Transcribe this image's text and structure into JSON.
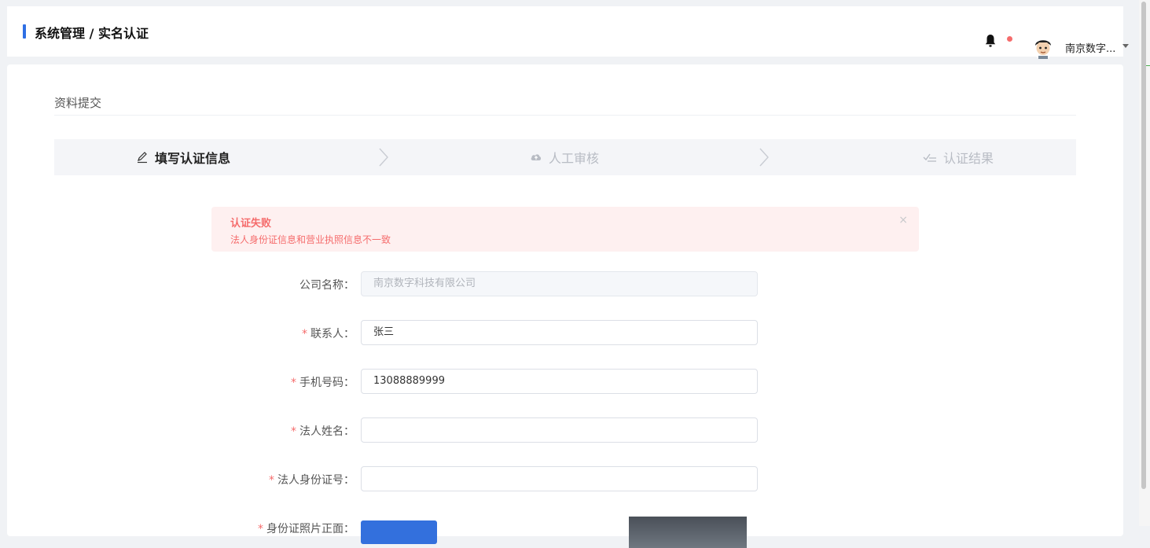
{
  "header": {
    "breadcrumb": "系统管理 / 实名认证",
    "user_name": "南京数字..."
  },
  "section": {
    "title": "资料提交"
  },
  "steps": [
    {
      "label": "填写认证信息",
      "icon": "edit-icon",
      "state": "active"
    },
    {
      "label": "人工审核",
      "icon": "cloud-upload-icon",
      "state": "inactive"
    },
    {
      "label": "认证结果",
      "icon": "check-list-icon",
      "state": "inactive"
    }
  ],
  "alert": {
    "title": "认证失败",
    "description": "法人身份证信息和营业执照信息不一致",
    "close": "×"
  },
  "form": {
    "company_name": {
      "label": "公司名称：",
      "value": "南京数字科技有限公司",
      "required": false
    },
    "contact": {
      "label": "联系人：",
      "value": "张三",
      "required": true
    },
    "phone": {
      "label": "手机号码：",
      "value": "13088889999",
      "required": true
    },
    "legal_name": {
      "label": "法人姓名：",
      "value": "",
      "required": true
    },
    "legal_id": {
      "label": "法人身份证号：",
      "value": "",
      "required": true
    },
    "id_photo_front": {
      "label": "身份证照片正面：",
      "required": true
    }
  },
  "colors": {
    "accent": "#2f6fe4",
    "error": "#f56c6c",
    "error_bg": "#fef0f0",
    "primary_button": "#3370dd"
  }
}
